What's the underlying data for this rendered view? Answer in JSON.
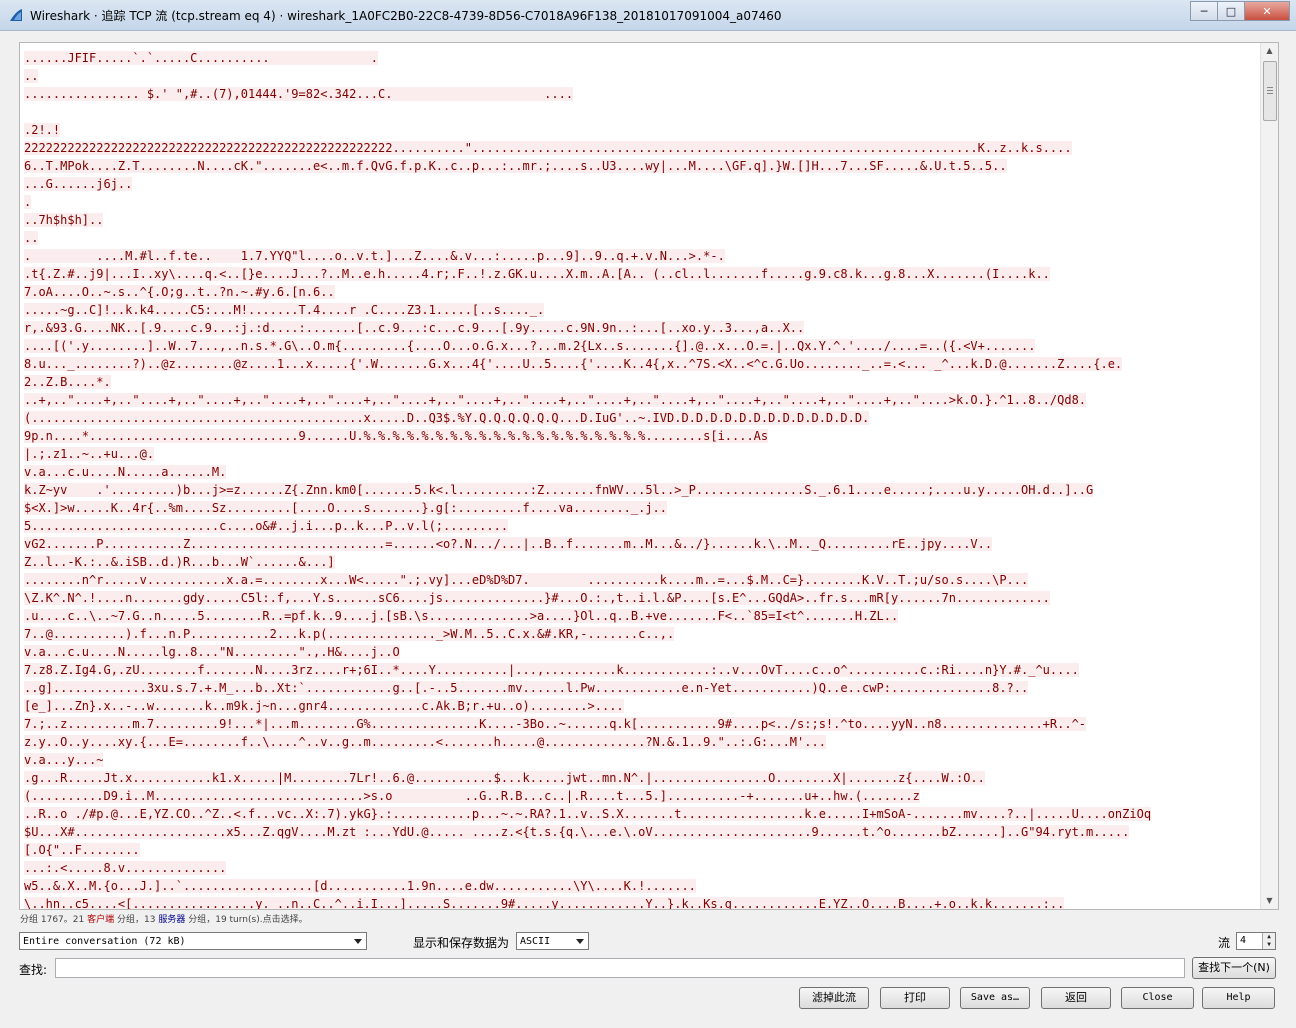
{
  "window": {
    "title": "Wireshark · 追踪 TCP 流 (tcp.stream eq 4) · wireshark_1A0FC2B0-22C8-4739-8D56-C7018A96F138_20181017091004_a07460",
    "icon": "wireshark-fin-icon",
    "controls": {
      "minimize": "─",
      "maximize": "□",
      "close": "✕"
    }
  },
  "stream": {
    "lines": [
      "......JFIF.....`.`.....C..........              .",
      "..",
      "................ $.' \",#..(7),01444.'9=82<.342...C.                     ....",
      "",
      ".2!.!",
      "222222222222222222222222222222222222222222222222222..........\"......................................................................K..z..k.s....",
      "6..T.MPok....Z.T........N....cK.\".......e<..m.f.QvG.f.p.K..c..p...:..mr.;....s..U3....wy|...M....\\GF.q].}W.[]H...7...SF.....&.U.t.5..5..",
      "...G......j6j..",
      ".",
      "..7h$h$h]..",
      "..",
      ".         ....M.#l..f.te..    1.7.YYQ\"l....o..v.t.]...Z....&.v...:.....p...9]..9..q.+.v.N...>.*-.",
      ".t{.Z.#..j9|...I..xy\\....q.<..[}e....J...?..M..e.h.....4.r;.F..!.z.GK.u....X.m..A.[A.. (..cl..l.......f.....g.9.c8.k...g.8...X.......(I....k..",
      "7.oA....O..~.s..^{.O;g..t..?n.~.#y.6.[n.6..",
      ".....~g..C]!..k.k4.....C5:...M!.......T.4....r .C....Z3.1.....[..s...._.",
      "r,.&93.G....NK..[.9....c.9...:j.:d....:.......[..c.9...:c...c.9...[.9y.....c.9N.9n..:...[..xo.y..3...,a..X..",
      "....[('.y........]..W..7...,..n.s.*.G\\..O.m{.........{....O...o.G.x...?...m.2{Lx..s.......{].@..x...O.=.|..Qx.Y.^.'..../....=..({.<V+.......",
      "8.u..._........?)..@z........@z....1...x.....{'.W.......G.x...4{'....U..5....{'....K..4{,x..^7S.<X..<^c.G.Uo........_..=.<... _^...k.D.@.......Z....{.e.",
      "2..Z.B....*.",
      "..+,..\"....+,..\"....+,..\"....+,..\"....+,..\"....+,..\"....+,..\"....+,..\"....+,..\"....+,..\"....+,..\"....+,..\"....+,..\"....+,..\"....>k.O.}.^1..8../Qd8.",
      "(..............................................x.....D..Q3$.%Y.Q.Q.Q.Q.Q.Q...D.IuG'..~.IVD.D.D.D.D.D.D.D.D.D.D.D.D.D.",
      "9p.n....*.............................9......U.%.%.%.%.%.%.%.%.%.%.%.%.%.%.%.%.%.%.%.%........s[i....As",
      "|.;.z1..~..+u...@.",
      "v.a...c.u....N.....a......M.",
      "k.Z~yv    .'.........)b...j>=z......Z{.Znn.km0[.......5.k<.l..........:Z.......fnWV...5l..>_P...............S._.6.1....e.....;....u.y.....OH.d..]..G",
      "$<X.]>w.....K..4r{..%m....Sz.........[....O....s.......}.g[:.........f....va........_.j..",
      "5..........................c....o&#..j.i...p..k...P..v.l(;.........",
      "vG2.......P...........Z...........................=......<o?.N.../...|..B..f.......m..M...&../}......k.\\..M.._Q.........rE..jpy....V..",
      "Z..l..-K.:..&.iSB..d.)R...b...W`......&...]",
      "........n^r.....v...........x.a.=........x...W<.....\".;.vy]...eD%D%D7.        ..........k....m..=...$.M..C=}........K.V..T.;u/so.s....\\P...",
      "\\Z.K^.N^.!....n.......gdy.....C5l:.f,...Y.s......sC6....js..............}#...O.:.,t..i.l.&P....[s.E^...GQdA>..fr.s...mR[y......7n.............",
      ".u....c..\\..~7.G..n.....5........R..=pf.k..9....j.[sB.\\s..............>a....}Ol..q..B.+ve.......F<..`85=I<t^.......H.ZL..",
      "7..@..........).f...n.P...........2...k.p(..............._>W.M..5..C.x.&#.KR,-.......c..,.",
      "v.a...c.u....N.....lg..8...\"N.........\".,.H&....j..O",
      "7.z8.Z.Ig4.G,.zU........f.......N....3rz....r+;6I..*....Y..........|...,..........k............:..v...OvT....c..o^..........c.:Ri....n}Y.#._^u....",
      "..g].............3xu.s.7.+.M_...b..Xt:`............g..[.-..5.......mv......l.Pw............e.n-Yet...........)Q..e..cwP:..............8.?..",
      "[e_]...Zn}.x..-..w.......k..m9k.j~n...gnr4.............c.Ak.B;r.+u..o)........>....",
      "7.;..z.........m.7.........9!...*|...m........G%...............K....-3Bo..~......q.k[...........9#....p<../s:;s!.^to....yyN..n8..............+R..^-",
      "z.y..O..y....xy.{...E=........f..\\....^..v..g..m.........<.......h.....@..............?N.&.1..9.\"..:.G:...M'...",
      "v.a...y...~",
      ".g...R.....Jt.x...........k1.x.....|M........7Lr!..6.@...........$...k.....jwt..mn.N^.|................O........X|.......z{....W.:O..",
      "(..........D9.i..M.............................>s.o          ..G..R.B...c..|.R....t...5.]..........-+.......u+..hw.(.......z",
      "..R..o ./#p.@...E,YZ.CO..^Z..<.f...vc..X:.7).ykG}.:...........p...~.~.RA?.1..v..S.X.......t.................k.e.....I+mSoA-.......mv....?..|.....U....onZiOq",
      "$U...X#.....................x5...Z.qgV....M.zt :...YdU.@..... ....z.<{t.s.{q.\\...e.\\.oV......................9......t.^o.......bZ......]..G\"94.ryt.m.....",
      "[.O{\"..F........",
      "...:.<.....8.v..............",
      "w5..&.X..M.{o...J.]..`..................[d...........1.9n....e.dw...........\\Y\\....K.!.......",
      "\\..hn..c5....<[.................y. ..n..C..^..i.I...].....S.......9#.....y............Y..}.k..Ks.g............E.YZ..O....B....+.o..k.k.......:.."
    ]
  },
  "status": {
    "pre": "分组 1767。",
    "client_count": "21",
    "client_label": "客户端",
    "mid": "分组，",
    "server_count": "13",
    "server_label": "服务器",
    "post": "分组，19 turn(s).点击选择。"
  },
  "controls": {
    "conversation_select": "Entire conversation (72 kB)",
    "show_as_label": "显示和保存数据为",
    "encoding_select": "ASCII",
    "stream_label": "流",
    "stream_value": "4",
    "find_label": "查找:",
    "find_value": "",
    "find_next_button": "查找下一个(N)"
  },
  "buttons": {
    "filter_out": "滤掉此流",
    "print": "打印",
    "save_as": "Save as…",
    "back": "返回",
    "close": "Close",
    "help": "Help"
  }
}
